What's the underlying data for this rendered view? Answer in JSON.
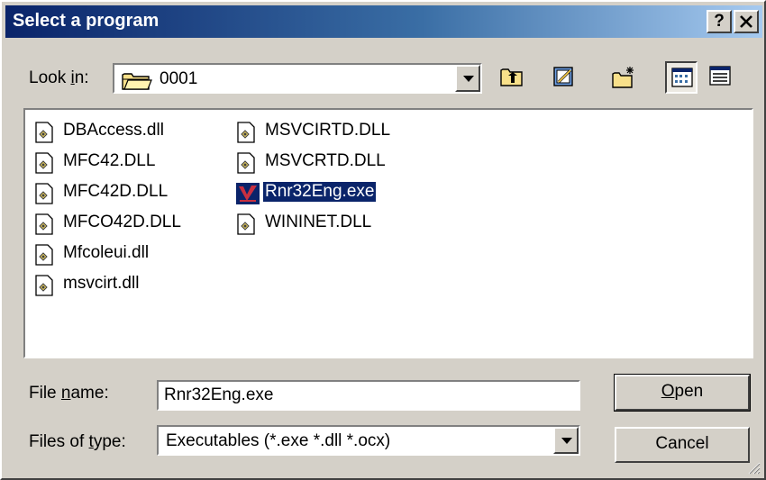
{
  "window": {
    "title": "Select a program",
    "help_label": "?",
    "close_label": "✕"
  },
  "lookin": {
    "label_pre": "Look ",
    "label_accel": "i",
    "label_post": "n:",
    "value": "0001"
  },
  "files": [
    {
      "name": "DBAccess.dll",
      "icon": "dll-file-icon"
    },
    {
      "name": "MFC42.DLL",
      "icon": "dll-file-icon"
    },
    {
      "name": "MFC42D.DLL",
      "icon": "dll-file-icon"
    },
    {
      "name": "MFCO42D.DLL",
      "icon": "dll-file-icon"
    },
    {
      "name": "Mfcoleui.dll",
      "icon": "dll-file-icon"
    },
    {
      "name": "msvcirt.dll",
      "icon": "dll-file-icon"
    },
    {
      "name": "MSVCIRTD.DLL",
      "icon": "dll-file-icon"
    },
    {
      "name": "MSVCRTD.DLL",
      "icon": "dll-file-icon"
    },
    {
      "name": "Rnr32Eng.exe",
      "icon": "exe-program-icon",
      "selected": true
    },
    {
      "name": "WININET.DLL",
      "icon": "dll-file-icon"
    }
  ],
  "filename": {
    "label_pre": "File ",
    "label_accel": "n",
    "label_post": "ame:",
    "value": "Rnr32Eng.exe"
  },
  "filetype": {
    "label_pre": "Files of ",
    "label_accel": "t",
    "label_post": "ype:",
    "value": "Executables (*.exe *.dll *.ocx)"
  },
  "buttons": {
    "open_accel": "O",
    "open_rest": "pen",
    "cancel": "Cancel"
  },
  "colors": {
    "title_active": "#0a246a",
    "selection": "#0a246a",
    "face": "#d4d0c8"
  }
}
